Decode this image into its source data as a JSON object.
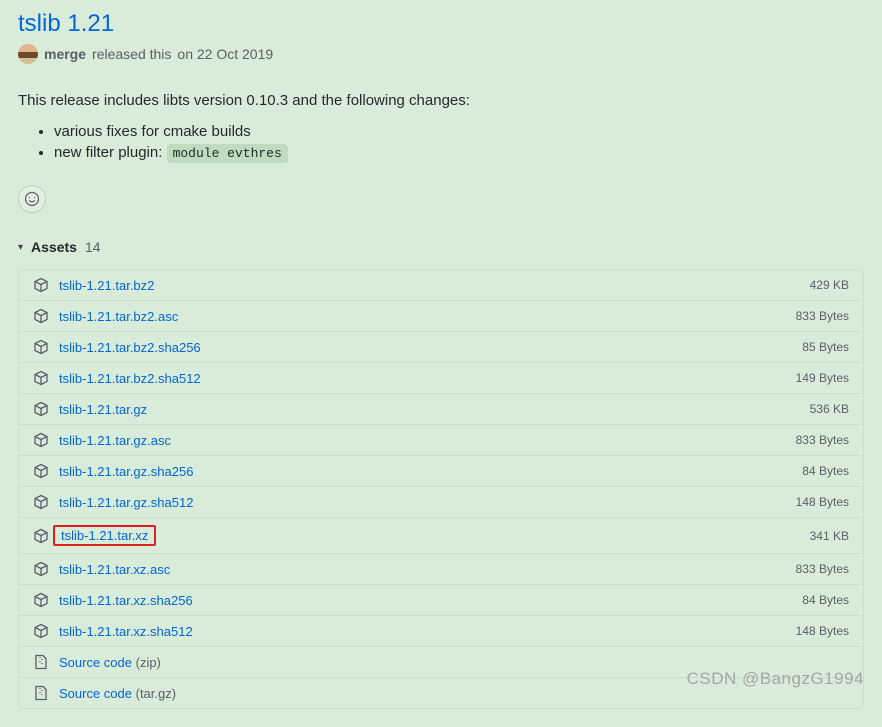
{
  "release": {
    "title": "tslib 1.21",
    "author": "merge",
    "released_text": "released this",
    "date_text": "on 22 Oct 2019",
    "body_intro": "This release includes libts version 0.10.3 and the following changes:",
    "changes": [
      {
        "text": "various fixes for cmake builds",
        "code": ""
      },
      {
        "text": "new filter plugin: ",
        "code": "module evthres"
      }
    ]
  },
  "assets": {
    "label": "Assets",
    "count": "14",
    "items": [
      {
        "name": "tslib-1.21.tar.bz2",
        "size": "429 KB",
        "type": "pkg",
        "highlight": false
      },
      {
        "name": "tslib-1.21.tar.bz2.asc",
        "size": "833 Bytes",
        "type": "pkg",
        "highlight": false
      },
      {
        "name": "tslib-1.21.tar.bz2.sha256",
        "size": "85 Bytes",
        "type": "pkg",
        "highlight": false
      },
      {
        "name": "tslib-1.21.tar.bz2.sha512",
        "size": "149 Bytes",
        "type": "pkg",
        "highlight": false
      },
      {
        "name": "tslib-1.21.tar.gz",
        "size": "536 KB",
        "type": "pkg",
        "highlight": false
      },
      {
        "name": "tslib-1.21.tar.gz.asc",
        "size": "833 Bytes",
        "type": "pkg",
        "highlight": false
      },
      {
        "name": "tslib-1.21.tar.gz.sha256",
        "size": "84 Bytes",
        "type": "pkg",
        "highlight": false
      },
      {
        "name": "tslib-1.21.tar.gz.sha512",
        "size": "148 Bytes",
        "type": "pkg",
        "highlight": false
      },
      {
        "name": "tslib-1.21.tar.xz",
        "size": "341 KB",
        "type": "pkg",
        "highlight": true
      },
      {
        "name": "tslib-1.21.tar.xz.asc",
        "size": "833 Bytes",
        "type": "pkg",
        "highlight": false
      },
      {
        "name": "tslib-1.21.tar.xz.sha256",
        "size": "84 Bytes",
        "type": "pkg",
        "highlight": false
      },
      {
        "name": "tslib-1.21.tar.xz.sha512",
        "size": "148 Bytes",
        "type": "pkg",
        "highlight": false
      },
      {
        "name": "Source code",
        "suffix": "(zip)",
        "size": "",
        "type": "src",
        "highlight": false
      },
      {
        "name": "Source code",
        "suffix": "(tar.gz)",
        "size": "",
        "type": "src",
        "highlight": false
      }
    ]
  },
  "watermark": "CSDN @BangzG1994"
}
